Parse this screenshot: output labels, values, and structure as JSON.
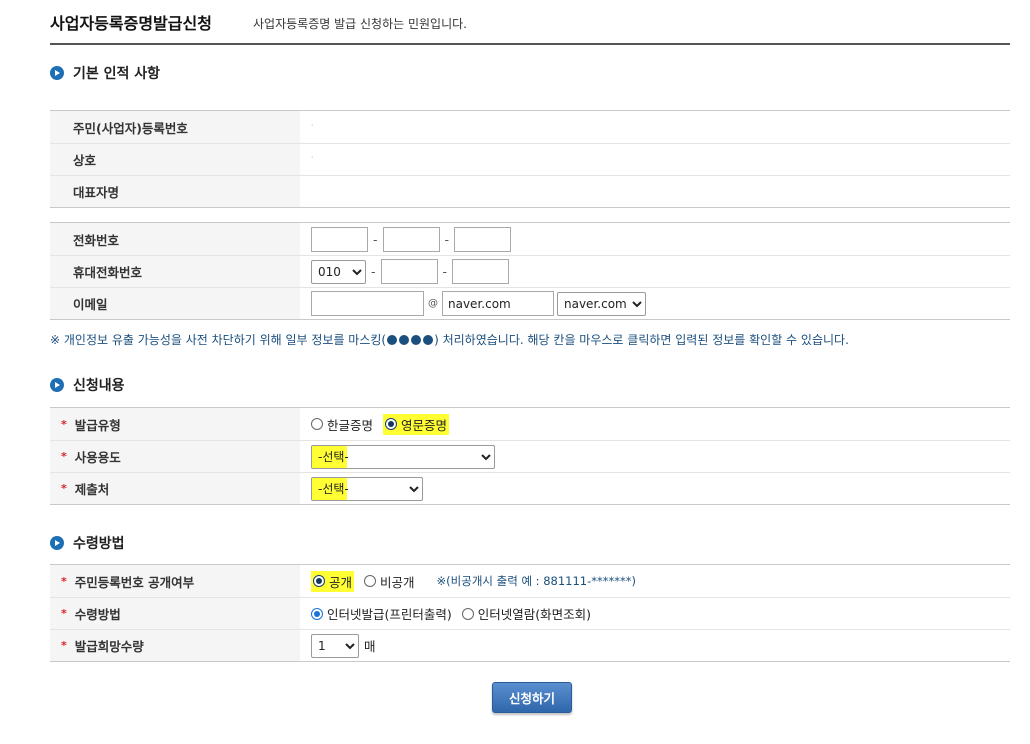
{
  "header": {
    "title": "사업자등록증명발급신청",
    "description": "사업자등록증명 발급 신청하는 민원입니다."
  },
  "section_basic": {
    "title": "기본 인적 사항",
    "rows": [
      {
        "label": "주민(사업자)등록번호",
        "value": ""
      },
      {
        "label": "상호",
        "value": ""
      },
      {
        "label": "대표자명",
        "value": ""
      }
    ]
  },
  "contact": {
    "phone": {
      "label": "전화번호",
      "part1": "",
      "part2": "",
      "part3": "",
      "separator": "-"
    },
    "mobile": {
      "label": "휴대전화번호",
      "prefix": "010",
      "part2": "",
      "part3": "",
      "separator": "-"
    },
    "email": {
      "label": "이메일",
      "local": "",
      "at": "@",
      "domain": "naver.com",
      "domain_select": "naver.com"
    }
  },
  "notice": {
    "prefix": "※ 개인정보 유출 가능성을 사전 차단하기 위해 일부 정보를 마스킹(",
    "suffix": ") 처리하였습니다. 해당 칸을 마우스로 클릭하면 입력된 정보를 확인할 수 있습니다."
  },
  "section_apply": {
    "title": "신청내용",
    "issue_type": {
      "label": "발급유형",
      "options": [
        "한글증명",
        "영문증명"
      ],
      "selected": "영문증명"
    },
    "purpose": {
      "label": "사용용도",
      "selected": "-선택-"
    },
    "destination": {
      "label": "제출처",
      "selected": "-선택-"
    }
  },
  "section_receive": {
    "title": "수령방법",
    "disclose": {
      "label": "주민등록번호 공개여부",
      "options": [
        "공개",
        "비공개"
      ],
      "selected": "공개",
      "hint": "※(비공개시 출력 예 : 881111-*******)"
    },
    "method": {
      "label": "수령방법",
      "options": [
        "인터넷발급(프린터출력)",
        "인터넷열람(화면조회)"
      ],
      "selected": "인터넷발급(프린터출력)"
    },
    "quantity": {
      "label": "발급희망수량",
      "selected": "1",
      "unit": "매"
    }
  },
  "required_mark": "*",
  "submit_label": "신청하기",
  "colors": {
    "accent": "#1e6fb5",
    "highlight": "#ffff33",
    "required": "#dd2222",
    "button": "#2f67ab"
  }
}
